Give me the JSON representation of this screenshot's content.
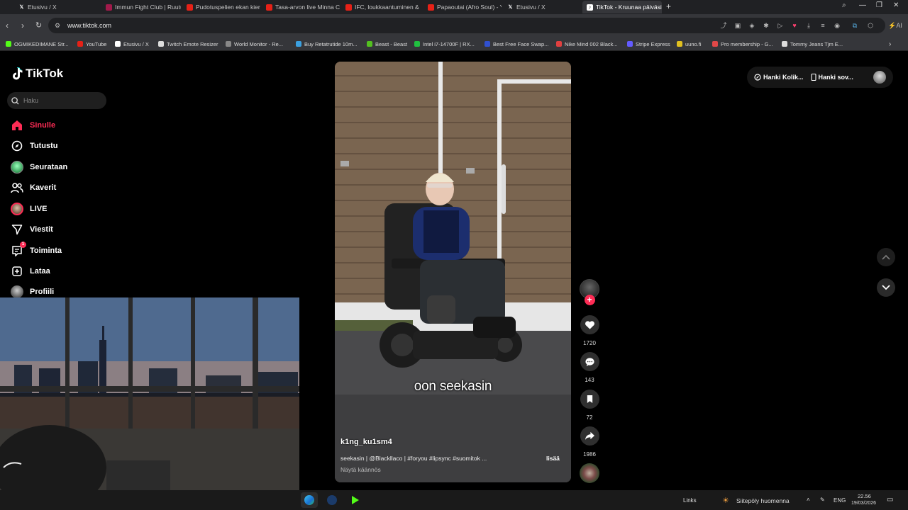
{
  "browser": {
    "tabs": [
      {
        "title": "Etusivu / X",
        "icon": "x-icon"
      },
      {
        "title": "Immun Fight Club | Ruutu",
        "icon": "ruutu-icon"
      },
      {
        "title": "Pudotuspelien ekan kierro",
        "icon": "youtube-icon"
      },
      {
        "title": "Tasa-arvon live Minna Can",
        "icon": "youtube-icon"
      },
      {
        "title": "IFC, loukkaantuminen &",
        "icon": "youtube-icon"
      },
      {
        "title": "Papaoutai (Afro Soul) - Yo",
        "icon": "youtube-icon"
      },
      {
        "title": "Etusivu / X",
        "icon": "x-icon"
      },
      {
        "title": "TikTok - Kruunaa päiväsi",
        "icon": "tiktok-icon"
      }
    ],
    "active_tab": 7,
    "url": "www.tiktok.com",
    "bookmarks": [
      {
        "label": "OGMIKEDIMANE Str...",
        "color": "#53fc18"
      },
      {
        "label": "YouTube",
        "color": "#e62117"
      },
      {
        "label": "Etusivu / X",
        "color": "#ffffff"
      },
      {
        "label": "Twitch Emote Resizer",
        "color": "#dddddd"
      },
      {
        "label": "World Monitor - Re...",
        "color": "#888888"
      },
      {
        "label": "Buy Retatrutide 10m...",
        "color": "#3ba0e0"
      },
      {
        "label": "Beast - Beast",
        "color": "#53c020"
      },
      {
        "label": "Intel i7-14700F | RX...",
        "color": "#20c040"
      },
      {
        "label": "Best Free Face Swap...",
        "color": "#3050d0"
      },
      {
        "label": "Nike Mind 002 Black...",
        "color": "#e04040"
      },
      {
        "label": "Stripe Express",
        "color": "#635bff"
      },
      {
        "label": "uuno.fi",
        "color": "#e0c020"
      },
      {
        "label": "Pro membership - G...",
        "color": "#e04848"
      },
      {
        "label": "Tommy Jeans Tjm E...",
        "color": "#dddddd"
      }
    ]
  },
  "tiktok": {
    "logo_text": "TikTok",
    "search_placeholder": "Haku",
    "menu": [
      {
        "label": "Sinulle",
        "icon": "home-icon",
        "active": true
      },
      {
        "label": "Tutustu",
        "icon": "compass-icon"
      },
      {
        "label": "Seurataan",
        "icon": "following-avatar-icon"
      },
      {
        "label": "Kaverit",
        "icon": "friends-icon"
      },
      {
        "label": "LIVE",
        "icon": "live-avatar-icon"
      },
      {
        "label": "Viestit",
        "icon": "send-icon"
      },
      {
        "label": "Toiminta",
        "icon": "activity-icon",
        "badge": "1"
      },
      {
        "label": "Lataa",
        "icon": "upload-icon"
      },
      {
        "label": "Profiili",
        "icon": "profile-avatar-icon"
      }
    ],
    "top_right": {
      "coins_label": "Hanki Kolik...",
      "app_label": "Hanki sov..."
    },
    "video": {
      "caption_overlay": "oon seekasin",
      "author": "k1ng_ku1sm4",
      "description": "seekasin | @Blackllaco | #foryou #lipsync #suomitok ...",
      "more_label": "lisää",
      "translate_label": "Näytä käännös"
    },
    "actions": {
      "likes": "1720",
      "comments": "143",
      "saves": "72",
      "shares": "1986"
    },
    "accent_color": "#fe2c55"
  },
  "taskbar": {
    "links_label": "Links",
    "weather_text": "Siitepöly huomenna",
    "language": "ENG",
    "time": "22.56",
    "date": "19/03/2026"
  }
}
